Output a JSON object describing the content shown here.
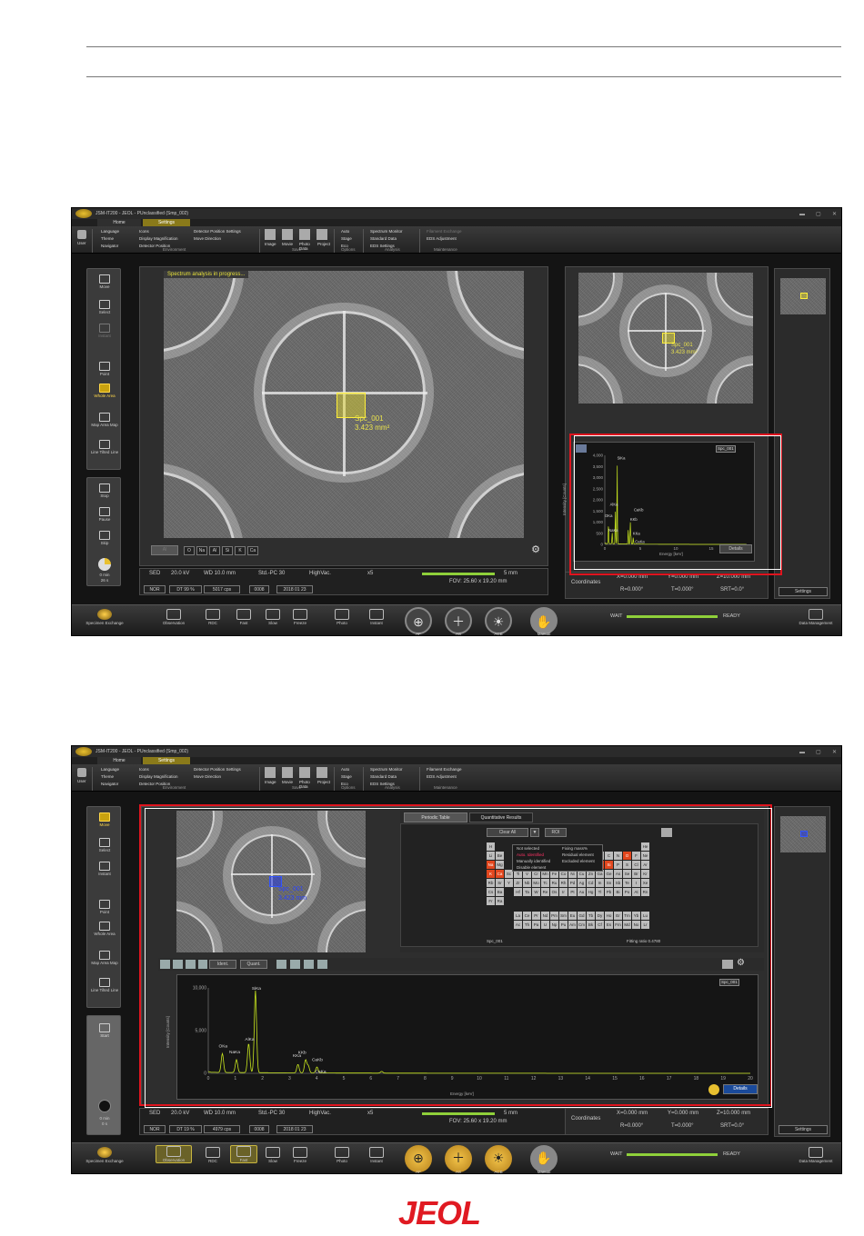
{
  "app": {
    "window_title": "JSM-IT200 - JEOL - PUnclassified (Smp_002)",
    "tabs": [
      "Home",
      "Settings"
    ]
  },
  "ribbon": {
    "user": "User",
    "environment": {
      "items": [
        "Language",
        "Theme",
        "Navigator",
        "Icons",
        "Display Magnification",
        "Detector Position",
        "Detector Position Settings",
        "Move Direction"
      ],
      "group": "Environment"
    },
    "save": {
      "items": [
        "Image",
        "Movie",
        "Photo Data",
        "Project"
      ],
      "group": "Save"
    },
    "options": {
      "items": [
        "Auto",
        "Stage",
        "Eco"
      ],
      "group": "Options"
    },
    "analysis": {
      "items": [
        "Spectrum Monitor",
        "Standard Data",
        "EDS Settings"
      ],
      "group": "Analysis"
    },
    "maintenance": {
      "items": [
        "Filament Exchange",
        "EDS Adjustment"
      ],
      "group": "Maintenance"
    }
  },
  "left_tools": {
    "move": "Move",
    "select": "Select",
    "instant": "Instant",
    "point": "Point",
    "whole_area": "Whole Area",
    "map": "Map Area Map",
    "line": "Line Tilted Line",
    "stop": "Stop",
    "pause": "Pause",
    "skip": "Skip",
    "start": "Start"
  },
  "screen1": {
    "progress": "Spectrum analysis in progress...",
    "roi_name": "Spc_001",
    "roi_area": "3.423 mm²",
    "timer": [
      "0 min",
      "26 s"
    ],
    "elements_row": [
      "Al",
      "O",
      "Na",
      "Al",
      "Si",
      "K",
      "Ca"
    ],
    "status": {
      "sed": "SED",
      "kv": "20.0 kV",
      "wd": "WD 10.0 mm",
      "pc": "Std.-PC 30",
      "vac": "HighVac.",
      "mag": "x5",
      "nor": "NOR",
      "dt": "DT 99 %",
      "cps": "5017 cps",
      "num": "0008",
      "date": "2018 01 23",
      "scale": "5 mm",
      "fov": "FOV: 25.60 x 19.20 mm"
    },
    "spectrum": {
      "tag": "Spc_001",
      "yticks": [
        "4,000",
        "3,500",
        "3,000",
        "2,500",
        "2,000",
        "1,500",
        "1,000",
        "500",
        "0"
      ],
      "xticks": [
        "0",
        "5",
        "10",
        "15",
        "20"
      ],
      "xlabel": "Energy [keV]",
      "ylabel": "Intensity [Counts]",
      "peaks": [
        "SiKa",
        "AlKa",
        "OKa",
        "NaKa",
        "KKb",
        "CaKb",
        "KKa",
        "CaKa"
      ],
      "details": "Details"
    },
    "coords": {
      "label": "Coordinates",
      "x": "X=0.000 mm",
      "y": "Y=0.000 mm",
      "z": "Z=10.000 mm",
      "r": "R=0.000°",
      "t": "T=0.000°",
      "srt": "SRT=0.0°"
    },
    "settings": "Settings"
  },
  "screen2": {
    "roi_name": "Spc_001",
    "roi_area": "3.423 mm",
    "timer": [
      "0 min",
      "0 s"
    ],
    "tabs": [
      "Periodic Table",
      "Quantitative Results"
    ],
    "clear_all": "Clear All",
    "roi": "ROI",
    "legend": [
      "Not selected",
      "Auto. Identified",
      "Manually identified",
      "Disable element",
      "Fixing mass%",
      "Residual element",
      "Excluded element"
    ],
    "fitting": "Fitting ratio  0.4780",
    "spc": "Spc_001",
    "toolbar": [
      "Ident.",
      "Quant."
    ],
    "spectrum": {
      "tag": "Spc_001",
      "yticks": [
        "10,000",
        "5,000",
        "0"
      ],
      "xticks": [
        "0",
        "1",
        "2",
        "3",
        "4",
        "5",
        "6",
        "7",
        "8",
        "9",
        "10",
        "11",
        "12",
        "13",
        "14",
        "15",
        "16",
        "17",
        "18",
        "19",
        "20"
      ],
      "xlabel": "Energy [keV]",
      "ylabel": "Intensity [Counts]",
      "peaks": [
        "SiKa",
        "AlKa",
        "OKa",
        "NaKa",
        "KKb",
        "KKa",
        "CaKb",
        "CaKa"
      ],
      "details": "Details"
    },
    "status": {
      "sed": "SED",
      "kv": "20.0 kV",
      "wd": "WD 10.0 mm",
      "pc": "Std.-PC 30",
      "vac": "HighVac.",
      "mag": "x5",
      "nor": "NOR",
      "dt": "DT 19 %",
      "cps": "4979 cps",
      "num": "0008",
      "date": "2018 01 23",
      "scale": "5 mm",
      "fov": "FOV: 25.60 x 19.20 mm"
    },
    "coords": {
      "label": "Coordinates",
      "x": "X=0.000 mm",
      "y": "Y=0.000 mm",
      "z": "Z=10.000 mm",
      "r": "R=0.000°",
      "t": "T=0.000°",
      "srt": "SRT=0.0°"
    },
    "settings": "Settings"
  },
  "bottom": {
    "specimen": "Specimen Exchange",
    "observation": "Observation",
    "rdc": "RDC",
    "fast": "Fast",
    "slow": "Slow",
    "freeze": "Freeze",
    "photo": "Photo",
    "instant": "Instant",
    "af": "AF",
    "as": "AS",
    "acb": "ACB",
    "manual": "Manual",
    "wait": "WAIT",
    "ready": "READY",
    "data": "Data Management"
  },
  "periodic": {
    "row1": [
      "H",
      "He"
    ],
    "row2": [
      "Li",
      "Be",
      "B",
      "C",
      "N",
      "O",
      "F",
      "Ne"
    ],
    "row3": [
      "Na",
      "Mg",
      "Al",
      "Si",
      "P",
      "S",
      "Cl",
      "Ar"
    ],
    "row4": [
      "K",
      "Ca",
      "Sc",
      "Ti",
      "V",
      "Cr",
      "Mn",
      "Fe",
      "Co",
      "Ni",
      "Cu",
      "Zn",
      "Ga",
      "Ge",
      "As",
      "Se",
      "Br",
      "Kr"
    ],
    "row5": [
      "Rb",
      "Sr",
      "Y",
      "Zr",
      "Nb",
      "Mo",
      "Tc",
      "Ru",
      "Rh",
      "Pd",
      "Ag",
      "Cd",
      "In",
      "Sn",
      "Sb",
      "Te",
      "I",
      "Xe"
    ],
    "row6": [
      "Cs",
      "Ba",
      "",
      "Hf",
      "Ta",
      "W",
      "Re",
      "Os",
      "Ir",
      "Pt",
      "Au",
      "Hg",
      "Tl",
      "Pb",
      "Bi",
      "Po",
      "At",
      "Rn"
    ],
    "row7": [
      "Fr",
      "Ra"
    ],
    "lan": [
      "La",
      "Ce",
      "Pr",
      "Nd",
      "Pm",
      "Sm",
      "Eu",
      "Gd",
      "Tb",
      "Dy",
      "Ho",
      "Er",
      "Tm",
      "Yb",
      "Lu"
    ],
    "act": [
      "Ac",
      "Th",
      "Pa",
      "U",
      "Np",
      "Pu",
      "Am",
      "Cm",
      "Bk",
      "Cf",
      "Es",
      "Fm",
      "Md",
      "No",
      "Lr"
    ],
    "selected": [
      "O",
      "Na",
      "Al",
      "Si",
      "K",
      "Ca"
    ]
  },
  "footer": {
    "logo": "JEOL"
  },
  "colors": {
    "accent_yellow": "#ffef3a",
    "frame_red": "#e0141e",
    "spectrum": "#c8e61e",
    "brand_red": "#e01a22"
  }
}
